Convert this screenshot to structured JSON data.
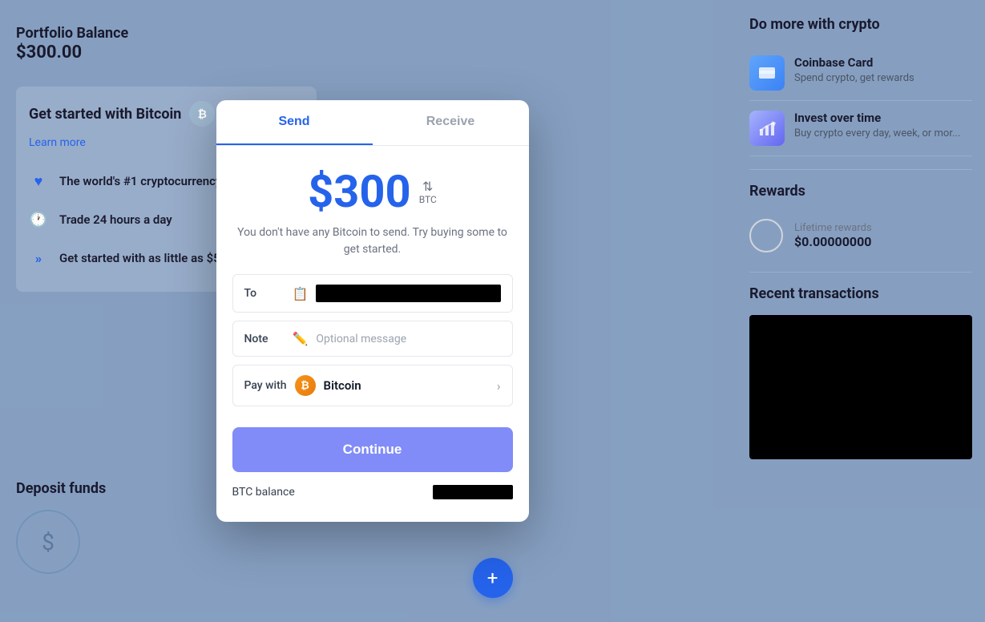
{
  "left": {
    "portfolio_label": "Portfolio Balance",
    "portfolio_amount": "$300.00",
    "bitcoin_section": {
      "title": "Get started with Bitcoin",
      "learn_more": "Learn more",
      "features": [
        {
          "icon": "heart",
          "text": "The world's #1 cryptocurrency"
        },
        {
          "icon": "clock",
          "text": "Trade 24 hours a day"
        },
        {
          "icon": "double-chevron",
          "text": "Get started with as little as $5"
        }
      ]
    },
    "deposit": {
      "title": "Deposit funds"
    }
  },
  "modal": {
    "tabs": [
      {
        "label": "Send",
        "active": true
      },
      {
        "label": "Receive",
        "active": false
      }
    ],
    "amount": "$300",
    "currency_toggle_label": "BTC",
    "no_balance_text": "You don't have any Bitcoin to send. Try buying some to get started.",
    "to_label": "To",
    "note_label": "Note",
    "note_placeholder": "Optional message",
    "pay_with_label": "Pay with",
    "payment_method": "Bitcoin",
    "continue_label": "Continue",
    "btc_balance_label": "BTC balance"
  },
  "right": {
    "do_more_title": "Do more with crypto",
    "cards": [
      {
        "name": "Coinbase Card",
        "desc": "Spend crypto, get rewards"
      },
      {
        "name": "Invest over time",
        "desc": "Buy crypto every day, week, or mor..."
      }
    ],
    "rewards": {
      "title": "Rewards",
      "lifetime_label": "Lifetime rewards",
      "lifetime_amount": "$0.00000000"
    },
    "recent_tx_title": "Recent transactions"
  },
  "fab": {
    "label": "+"
  }
}
